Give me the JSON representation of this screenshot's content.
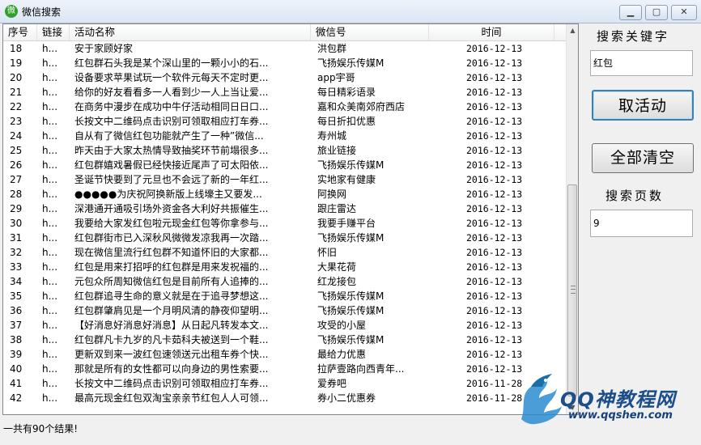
{
  "window": {
    "title": "微信搜索",
    "app_icon": "wechat-logo-icon",
    "accent": "#34a02b"
  },
  "table": {
    "headers": {
      "id": "序号",
      "link": "链接",
      "name": "活动名称",
      "wechat": "微信号",
      "time": "时间"
    },
    "rows": [
      {
        "id": "18",
        "link": "h...",
        "name": "安于家顾好家",
        "wechat": "洪包群",
        "time": "2016-12-13"
      },
      {
        "id": "19",
        "link": "h...",
        "name": "红包群石头我是某个深山里的一颗小小的石...",
        "wechat": "飞扬娱乐传媒M",
        "time": "2016-12-13"
      },
      {
        "id": "20",
        "link": "h...",
        "name": "设备要求苹果试玩一个软件元每天不定时更...",
        "wechat": "app宇哥",
        "time": "2016-12-13"
      },
      {
        "id": "21",
        "link": "h...",
        "name": "给你的好友看看多一人看到少一人上当让爱...",
        "wechat": "每日精彩语录",
        "time": "2016-12-13"
      },
      {
        "id": "22",
        "link": "h...",
        "name": "在商务中漫步在成功中牛仔活动相同日日口...",
        "wechat": "嘉和众美南郊府西店",
        "time": "2016-12-13"
      },
      {
        "id": "23",
        "link": "h...",
        "name": "长按文中二维码点击识别可领取相应打车券...",
        "wechat": "每日折扣优惠",
        "time": "2016-12-13"
      },
      {
        "id": "24",
        "link": "h...",
        "name": "自从有了微信红包功能就产生了一种”微信...",
        "wechat": "寿州城",
        "time": "2016-12-13"
      },
      {
        "id": "25",
        "link": "h...",
        "name": "昨天由于大家太热情导致抽奖环节前塌很多...",
        "wechat": "旅业链接",
        "time": "2016-12-13"
      },
      {
        "id": "26",
        "link": "h...",
        "name": "红包群嬉戏暑假已经快接近尾声了可太阳依...",
        "wechat": "飞扬娱乐传媒M",
        "time": "2016-12-13"
      },
      {
        "id": "27",
        "link": "h...",
        "name": "圣诞节快要到了元旦也不会远了新的一年红...",
        "wechat": "实地家有健康",
        "time": "2016-12-13"
      },
      {
        "id": "28",
        "link": "h...",
        "name": "●●●●●为庆祝阿换新版上线壕主又要发...",
        "wechat": "阿换网",
        "time": "2016-12-13"
      },
      {
        "id": "29",
        "link": "h...",
        "name": "深港通开通吸引场外资金各大利好共振催生...",
        "wechat": "跟庄雷达",
        "time": "2016-12-13"
      },
      {
        "id": "30",
        "link": "h...",
        "name": "我要给大家发红包啦元现金红包等你拿参与...",
        "wechat": "我要手赚平台",
        "time": "2016-12-13"
      },
      {
        "id": "31",
        "link": "h...",
        "name": "红包群街市已入深秋风微微发凉我再一次踏...",
        "wechat": "飞扬娱乐传媒M",
        "time": "2016-12-13"
      },
      {
        "id": "32",
        "link": "h...",
        "name": "现在微信里流行红包群不知道怀旧的大家都...",
        "wechat": "怀旧",
        "time": "2016-12-13"
      },
      {
        "id": "33",
        "link": "h...",
        "name": "红包是用来打招呼的红包群是用来发祝福的...",
        "wechat": "大果花荷",
        "time": "2016-12-13"
      },
      {
        "id": "34",
        "link": "h...",
        "name": "元包众所周知微信红包是目前所有人追捧的...",
        "wechat": "红龙接包",
        "time": "2016-12-13"
      },
      {
        "id": "35",
        "link": "h...",
        "name": "红包群追寻生命的意义就是在于追寻梦想这...",
        "wechat": "飞扬娱乐传媒M",
        "time": "2016-12-13"
      },
      {
        "id": "36",
        "link": "h...",
        "name": "红包群肇肩见是一个月明风清的静夜仰望明...",
        "wechat": "飞扬娱乐传媒M",
        "time": "2016-12-13"
      },
      {
        "id": "37",
        "link": "h...",
        "name": "【好消息好消息好消息】从日起凡转发本文...",
        "wechat": "攻受的小屋",
        "time": "2016-12-13"
      },
      {
        "id": "38",
        "link": "h...",
        "name": "红包群凡卡九岁的凡卡茹科夫被送到一个鞋...",
        "wechat": "飞扬娱乐传媒M",
        "time": "2016-12-13"
      },
      {
        "id": "39",
        "link": "h...",
        "name": "更新双到来一波红包速领送元出租车券个快...",
        "wechat": "最给力优惠",
        "time": "2016-12-13"
      },
      {
        "id": "40",
        "link": "h...",
        "name": "那就是所有的女性都可以向身边的男性索要...",
        "wechat": "拉萨壹路向西青年...",
        "time": "2016-12-13"
      },
      {
        "id": "41",
        "link": "h...",
        "name": "长按文中二维码点击识别可领取相应打车券...",
        "wechat": "爱券吧",
        "time": "2016-11-28"
      },
      {
        "id": "42",
        "link": "h...",
        "name": "最高元现金红包双淘宝亲亲节红包人人可领...",
        "wechat": "券小二优惠券",
        "time": "2016-11-28"
      }
    ]
  },
  "sidebar": {
    "keyword_label": "搜索关键字",
    "keyword_value": "红包",
    "fetch_button": "取活动",
    "clear_button": "全部清空",
    "pages_label": "搜索页数",
    "pages_value": "9"
  },
  "status": {
    "text": "一共有90个结果!"
  },
  "watermark": {
    "logo_icon": "dragon-logo-icon",
    "text": "QQ神教程网",
    "url": "www.qqshen.com",
    "color": "#1b4e8a"
  }
}
